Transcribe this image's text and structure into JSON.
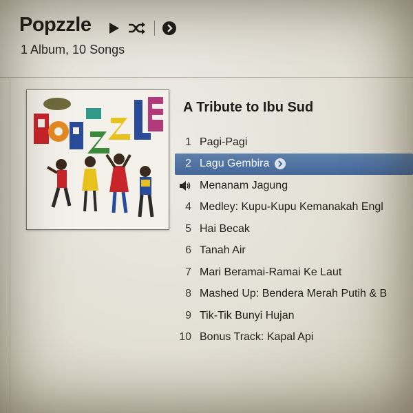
{
  "header": {
    "artist": "Popzzle",
    "summary": "1 Album, 10 Songs",
    "controls": [
      "play-icon",
      "shuffle-icon",
      "arrow-circle-icon"
    ]
  },
  "album": {
    "title": "A Tribute to Ibu Sud",
    "cover_text": "POPZZLE"
  },
  "tracks": [
    {
      "num": "1",
      "title": "Pagi-Pagi"
    },
    {
      "num": "2",
      "title": "Lagu Gembira",
      "selected": true
    },
    {
      "num": "",
      "title": "Menanam Jagung",
      "playing": true
    },
    {
      "num": "4",
      "title": "Medley: Kupu-Kupu Kemanakah Engl"
    },
    {
      "num": "5",
      "title": "Hai Becak"
    },
    {
      "num": "6",
      "title": "Tanah Air"
    },
    {
      "num": "7",
      "title": "Mari Beramai-Ramai Ke Laut"
    },
    {
      "num": "8",
      "title": "Mashed Up: Bendera Merah Putih & B"
    },
    {
      "num": "9",
      "title": "Tik-Tik Bunyi Hujan"
    },
    {
      "num": "10",
      "title": "Bonus Track: Kapal Api"
    }
  ],
  "colors": {
    "selection": "#4f729f",
    "cover_red": "#c8242a",
    "cover_blue": "#2a4a9a",
    "cover_yellow": "#e8c21c",
    "cover_green": "#3a8a3a"
  }
}
